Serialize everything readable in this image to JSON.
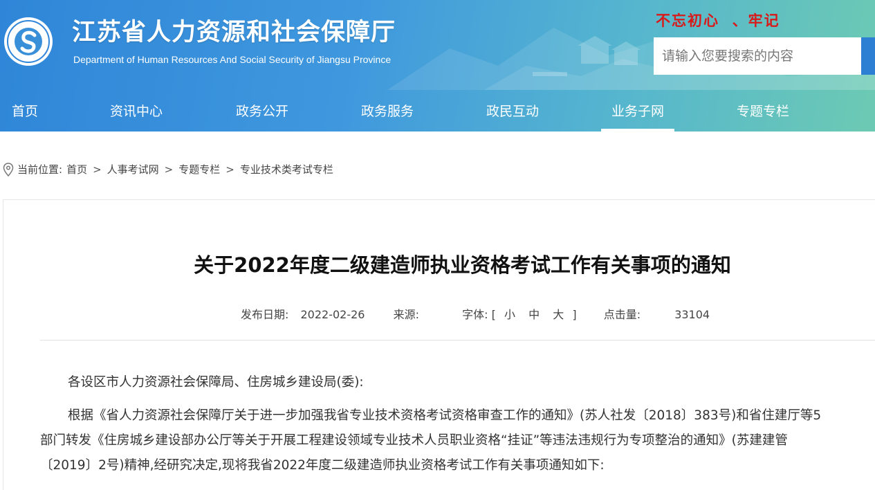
{
  "header": {
    "title": "江苏省人力资源和社会保障厅",
    "subtitle": "Department of Human Resources And Social Security of Jiangsu Province",
    "logo_text": "江苏省人力资源和社会保障厅",
    "slogan": "不忘初心  、牢记",
    "search": {
      "placeholder": "请输入您要搜索的内容"
    }
  },
  "nav": [
    {
      "label": "首页",
      "active": false
    },
    {
      "label": "资讯中心",
      "active": false
    },
    {
      "label": "政务公开",
      "active": false
    },
    {
      "label": "政务服务",
      "active": false
    },
    {
      "label": "政民互动",
      "active": false
    },
    {
      "label": "业务子网",
      "active": true
    },
    {
      "label": "专题专栏",
      "active": false
    }
  ],
  "breadcrumb": {
    "prefix": "当前位置:",
    "items": [
      "首页",
      "人事考试网",
      "专题专栏",
      "专业技术类考试专栏"
    ],
    "separator": ">"
  },
  "article": {
    "title": "关于2022年度二级建造师执业资格考试工作有关事项的通知",
    "meta": {
      "date_label": "发布日期:",
      "date": "2022-02-26",
      "source_label": "来源:",
      "source": "",
      "font_label": "字体:",
      "bracket_open": "[",
      "bracket_close": "]",
      "font_small": "小",
      "font_medium": "中",
      "font_large": "大",
      "clicks_label": "点击量:",
      "clicks": "33104"
    },
    "greeting": "各设区市人力资源社会保障局、住房城乡建设局(委):",
    "body_line1": "根据《省人力资源社会保障厅关于进一步加强我省专业技术资格考试资格审查工作的通知》(苏人社发〔2018〕383号)和省住建厅等5",
    "body_line2": "部门转发《住房城乡建设部办公厅等关于开展工程建设领域专业技术人员职业资格“挂证”等违法违规行为专项整治的通知》(苏建建管",
    "body_line3": "〔2019〕2号)精神,经研究决定,现将我省2022年度二级建造师执业资格考试工作有关事项通知如下:"
  },
  "colors": {
    "header_start": "#2f86d8",
    "header_end": "#6ccab3",
    "slogan": "#d81a1a",
    "search_button": "#2d7fd4"
  }
}
